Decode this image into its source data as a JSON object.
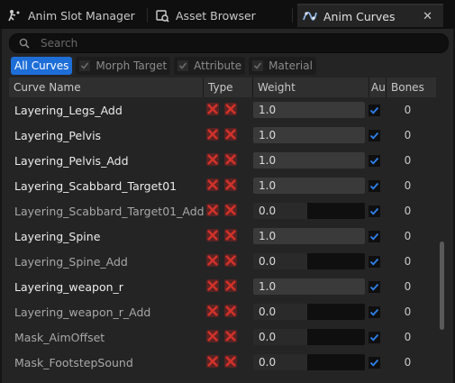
{
  "tabs": [
    {
      "label": "Anim Slot Manager",
      "icon": "anim-slot-icon",
      "active": false
    },
    {
      "label": "Asset Browser",
      "icon": "asset-browser-icon",
      "active": false
    },
    {
      "label": "Anim Curves",
      "icon": "anim-curves-icon",
      "active": true,
      "close": "✕"
    }
  ],
  "search": {
    "placeholder": "Search"
  },
  "filters": {
    "all": "All Curves",
    "morph": "Morph Target",
    "attribute": "Attribute",
    "material": "Material"
  },
  "columns": {
    "name": "Curve Name",
    "type": "Type",
    "weight": "Weight",
    "auto": "Au",
    "bones": "Bones"
  },
  "colors": {
    "accent": "#1e6ed8",
    "type_icon_red": "#d0322a",
    "background": "#242424"
  },
  "rows": [
    {
      "name": "Layering_Legs_Add",
      "weight": "1.0",
      "weight_fraction": 1.0,
      "auto": true,
      "bones": "0",
      "active": true
    },
    {
      "name": "Layering_Pelvis",
      "weight": "1.0",
      "weight_fraction": 1.0,
      "auto": true,
      "bones": "0",
      "active": true
    },
    {
      "name": "Layering_Pelvis_Add",
      "weight": "1.0",
      "weight_fraction": 1.0,
      "auto": true,
      "bones": "0",
      "active": true
    },
    {
      "name": "Layering_Scabbard_Target01",
      "weight": "1.0",
      "weight_fraction": 1.0,
      "auto": true,
      "bones": "0",
      "active": true
    },
    {
      "name": "Layering_Scabbard_Target01_Add",
      "weight": "0.0",
      "weight_fraction": 0.0,
      "auto": true,
      "bones": "0",
      "active": false
    },
    {
      "name": "Layering_Spine",
      "weight": "1.0",
      "weight_fraction": 1.0,
      "auto": true,
      "bones": "0",
      "active": true
    },
    {
      "name": "Layering_Spine_Add",
      "weight": "0.0",
      "weight_fraction": 0.0,
      "auto": true,
      "bones": "0",
      "active": false
    },
    {
      "name": "Layering_weapon_r",
      "weight": "1.0",
      "weight_fraction": 1.0,
      "auto": true,
      "bones": "0",
      "active": true
    },
    {
      "name": "Layering_weapon_r_Add",
      "weight": "0.0",
      "weight_fraction": 0.0,
      "auto": true,
      "bones": "0",
      "active": false
    },
    {
      "name": "Mask_AimOffset",
      "weight": "0.0",
      "weight_fraction": 0.0,
      "auto": true,
      "bones": "0",
      "active": false
    },
    {
      "name": "Mask_FootstepSound",
      "weight": "0.0",
      "weight_fraction": 0.0,
      "auto": true,
      "bones": "0",
      "active": false
    }
  ]
}
